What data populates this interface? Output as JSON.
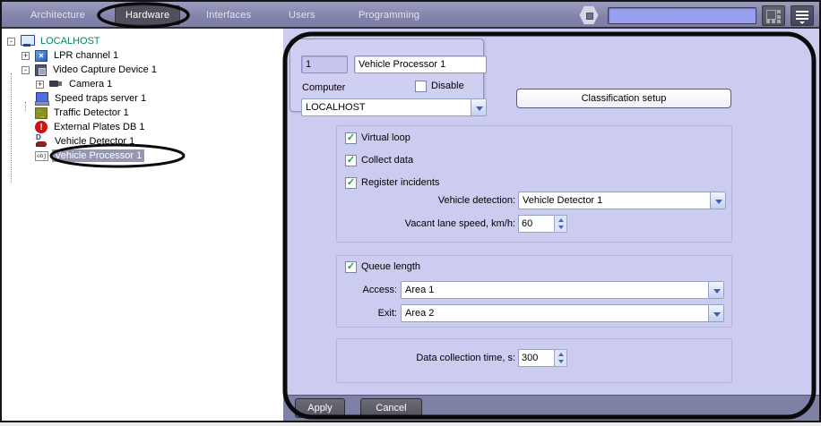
{
  "colors": {
    "menubar": "#8183aa",
    "active_tab": "#50505d",
    "search_field": "#98a1f0",
    "panel_bg": "#cbccef",
    "footer_bg": "#7e80a6",
    "selection": "#9596b3",
    "localhost_text": "#0d7a60",
    "check_green": "#1fa038",
    "annotation": "#0a0a0a"
  },
  "menubar": {
    "tabs": [
      {
        "label": "Architecture",
        "active": false
      },
      {
        "label": "Hardware",
        "active": true
      },
      {
        "label": "Interfaces",
        "active": false
      },
      {
        "label": "Users",
        "active": false
      },
      {
        "label": "Programming",
        "active": false
      }
    ],
    "search": {
      "value": "",
      "placeholder": ""
    },
    "icons": {
      "left": "gear-hex-icon",
      "right1": "screen-layouts-grid-icon",
      "right2": "menu-lines-arrow-icon"
    }
  },
  "tree": {
    "items": [
      {
        "label": "LOCALHOST",
        "level": 0,
        "expand": "-",
        "icon": "computer-icon",
        "selected": false
      },
      {
        "label": "LPR channel 1",
        "level": 1,
        "expand": "+",
        "icon": "lpr-channel-icon",
        "selected": false
      },
      {
        "label": "Video Capture Device 1",
        "level": 1,
        "expand": "-",
        "icon": "video-capture-device-icon",
        "selected": false
      },
      {
        "label": "Camera 1",
        "level": 2,
        "expand": "+",
        "icon": "camera-icon",
        "selected": false
      },
      {
        "label": "Speed traps server 1",
        "level": 1,
        "expand": "",
        "icon": "server-icon",
        "selected": false
      },
      {
        "label": "Traffic Detector 1",
        "level": 1,
        "expand": "",
        "icon": "traffic-detector-icon",
        "selected": false
      },
      {
        "label": "External Plates DB 1",
        "level": 1,
        "expand": "",
        "icon": "alert-db-icon",
        "selected": false
      },
      {
        "label": "Vehicle Detector 1",
        "level": 1,
        "expand": "",
        "icon": "vehicle-detector-icon",
        "selected": false
      },
      {
        "label": "Vehicle Processor 1",
        "level": 1,
        "expand": "",
        "icon": "obj-icon",
        "icon_text": "obj",
        "selected": true
      }
    ]
  },
  "panel": {
    "identity": {
      "id": "1",
      "name": "Vehicle Processor 1",
      "computer_label": "Computer",
      "disable_label": "Disable",
      "disable_mark": "",
      "computer_value": "LOCALHOST"
    },
    "classification_button_label": "Classification setup",
    "detection_group": {
      "virtual_loop": {
        "label": "Virtual loop",
        "checked": true,
        "mark": "✓"
      },
      "collect_data": {
        "label": "Collect data",
        "checked": true,
        "mark": "✓"
      },
      "register_incidents": {
        "label": "Register incidents",
        "checked": true,
        "mark": "✓"
      },
      "vehicle_detection": {
        "label": "Vehicle detection:",
        "value": "Vehicle Detector 1"
      },
      "vacant_lane_speed": {
        "label": "Vacant lane speed, km/h:",
        "value": "60"
      }
    },
    "queue_group": {
      "queue_length": {
        "label": "Queue length",
        "checked": true,
        "mark": "✓"
      },
      "access": {
        "label": "Access:",
        "value": "Area 1"
      },
      "exit": {
        "label": "Exit:",
        "value": "Area 2"
      }
    },
    "collection_group": {
      "data_collection_time": {
        "label": "Data collection time, s:",
        "value": "300"
      }
    },
    "footer": {
      "apply_label": "Apply",
      "cancel_label": "Cancel"
    }
  }
}
